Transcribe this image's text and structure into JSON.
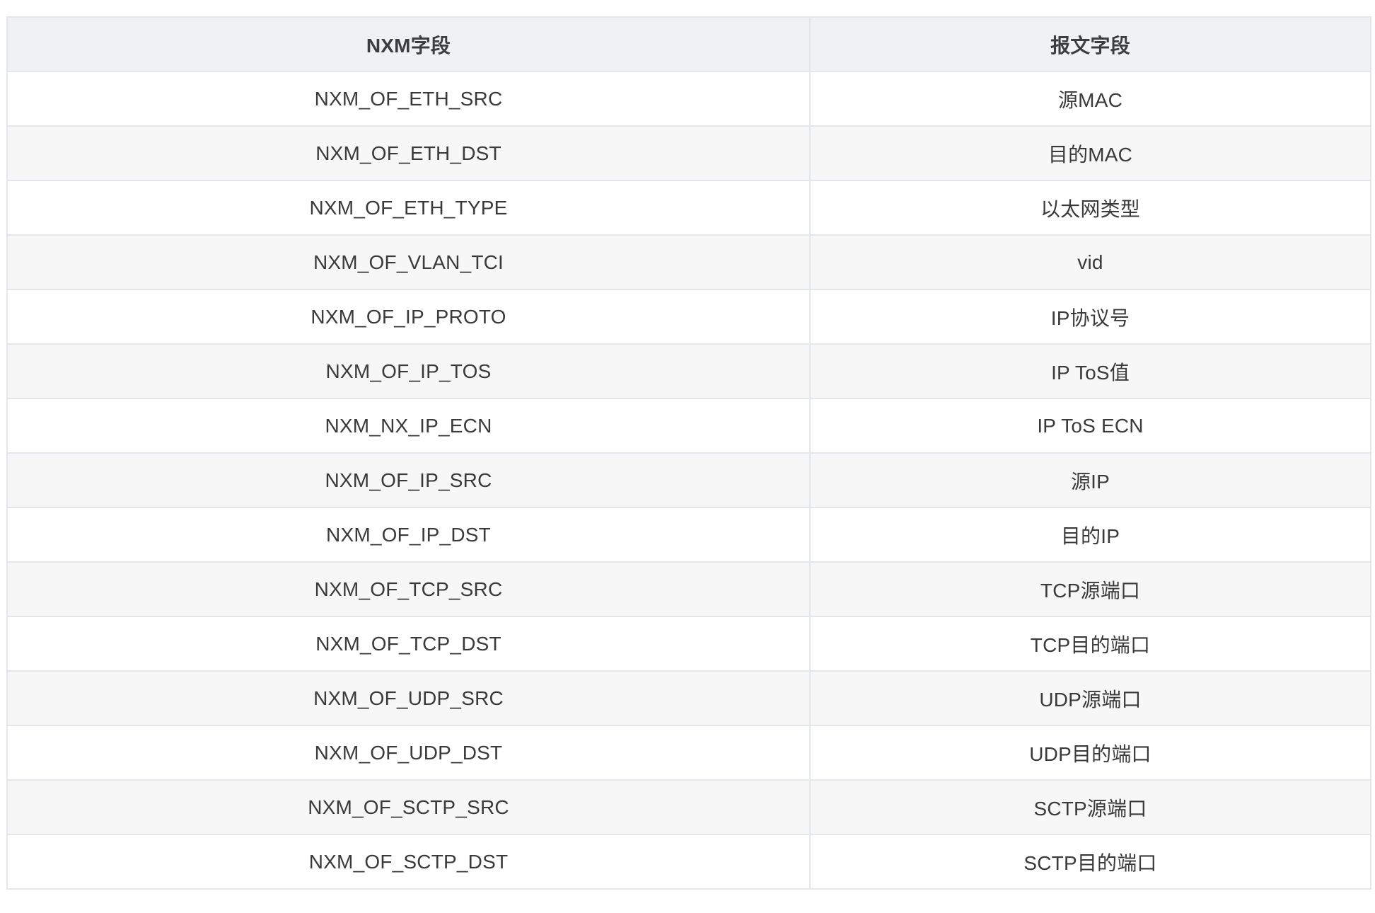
{
  "table": {
    "headers": [
      "NXM字段",
      "报文字段"
    ],
    "rows": [
      [
        "NXM_OF_ETH_SRC",
        "源MAC"
      ],
      [
        "NXM_OF_ETH_DST",
        "目的MAC"
      ],
      [
        "NXM_OF_ETH_TYPE",
        "以太网类型"
      ],
      [
        "NXM_OF_VLAN_TCI",
        "vid"
      ],
      [
        "NXM_OF_IP_PROTO",
        "IP协议号"
      ],
      [
        "NXM_OF_IP_TOS",
        "IP ToS值"
      ],
      [
        "NXM_NX_IP_ECN",
        "IP ToS ECN"
      ],
      [
        "NXM_OF_IP_SRC",
        "源IP"
      ],
      [
        "NXM_OF_IP_DST",
        "目的IP"
      ],
      [
        "NXM_OF_TCP_SRC",
        "TCP源端口"
      ],
      [
        "NXM_OF_TCP_DST",
        "TCP目的端口"
      ],
      [
        "NXM_OF_UDP_SRC",
        "UDP源端口"
      ],
      [
        "NXM_OF_UDP_DST",
        "UDP目的端口"
      ],
      [
        "NXM_OF_SCTP_SRC",
        "SCTP源端口"
      ],
      [
        "NXM_OF_SCTP_DST",
        "SCTP目的端口"
      ]
    ]
  },
  "colors": {
    "header_bg": "#eff2f5",
    "stripe_bg": "#f7f7f7",
    "border": "#e3e6ea",
    "text": "#3a3a3a"
  }
}
